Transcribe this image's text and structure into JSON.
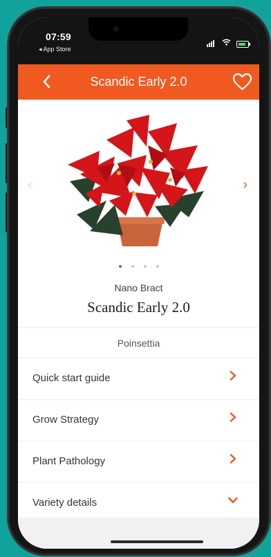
{
  "status_bar": {
    "time": "07:59",
    "back_app": "◂ App Store"
  },
  "header": {
    "title": "Scandic Early 2.0",
    "back_icon": "chevron-left-icon",
    "favorite_icon": "heart-outline-icon"
  },
  "colors": {
    "accent": "#f05a20",
    "background": "#11a39b"
  },
  "carousel": {
    "left_arrow": "‹",
    "right_arrow": "›",
    "active_index": 0,
    "total": 4
  },
  "product": {
    "series": "Nano Bract",
    "variety": "Scandic Early 2.0",
    "species": "Poinsettia"
  },
  "menu": {
    "items": [
      {
        "label": "Quick start guide",
        "icon": "chevron-right-icon"
      },
      {
        "label": "Grow Strategy",
        "icon": "chevron-right-icon"
      },
      {
        "label": "Plant Pathology",
        "icon": "chevron-right-icon"
      },
      {
        "label": "Variety details",
        "icon": "chevron-down-icon"
      }
    ]
  }
}
